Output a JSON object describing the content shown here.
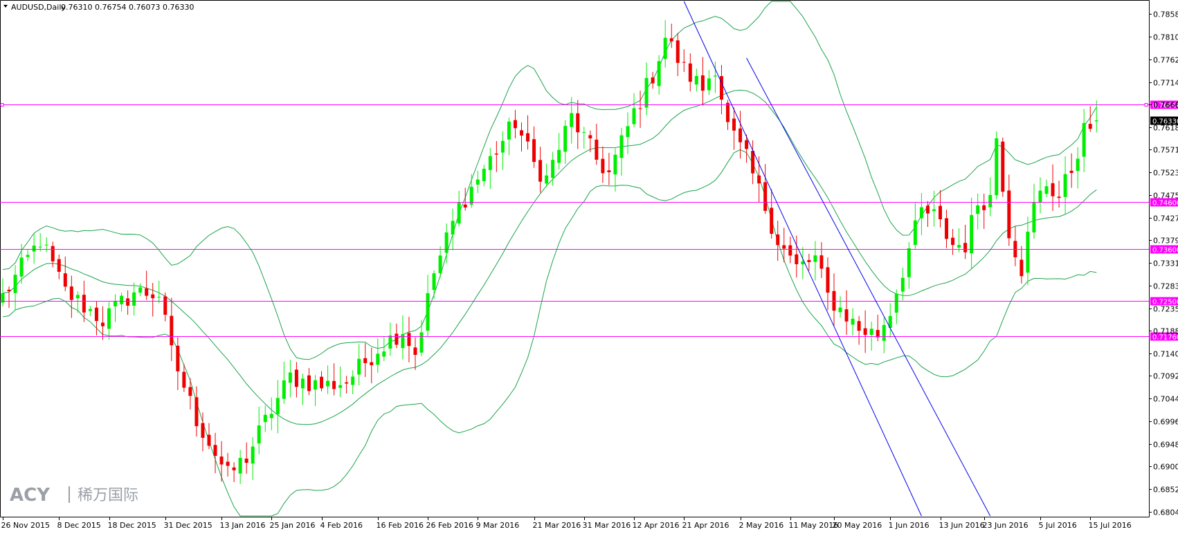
{
  "header": {
    "symbol": "AUDUSD,Daily",
    "ohlc": "0.76310 0.76754 0.76073 0.76330"
  },
  "logo": {
    "brand": "ACY",
    "cn": "稀万国际"
  },
  "colors": {
    "up": "#00ee00",
    "down": "#ee0000",
    "band": "#19a34a",
    "level": "#ff00ff",
    "channel": "#0000ee",
    "axis": "#000000",
    "current_price_bg": "#000000"
  },
  "chart_data": {
    "type": "candlestick",
    "symbol": "AUDUSD",
    "timeframe": "Daily",
    "ylim": [
      0.6795,
      0.7885
    ],
    "y_ticks": [
      "0.78580",
      "0.78100",
      "0.77620",
      "0.77140",
      "0.76660",
      "0.76180",
      "0.75710",
      "0.75230",
      "0.74750",
      "0.74270",
      "0.73790",
      "0.73310",
      "0.72830",
      "0.72350",
      "0.71880",
      "0.71400",
      "0.70920",
      "0.70440",
      "0.69960",
      "0.69480",
      "0.69000",
      "0.68520",
      "0.68040"
    ],
    "x_tick_labels": [
      "26 Nov 2015",
      "8 Dec 2015",
      "18 Dec 2015",
      "31 Dec 2015",
      "13 Jan 2016",
      "25 Jan 2016",
      "4 Feb 2016",
      "16 Feb 2016",
      "26 Feb 2016",
      "9 Mar 2016",
      "21 Mar 2016",
      "31 Mar 2016",
      "12 Apr 2016",
      "21 Apr 2016",
      "2 May 2016",
      "11 May 2016",
      "20 May 2016",
      "1 Jun 2016",
      "13 Jun 2016",
      "23 Jun 2016",
      "5 Jul 2016",
      "15 Jul 2016"
    ],
    "x_tick_index": [
      0,
      9,
      17,
      26,
      35,
      43,
      51,
      60,
      68,
      76,
      85,
      93,
      101,
      109,
      118,
      126,
      133,
      142,
      150,
      157,
      166,
      174
    ],
    "horizontal_levels": [
      {
        "value": 0.7666,
        "label": "0.76660"
      },
      {
        "value": 0.746,
        "label": "0.74600"
      },
      {
        "value": 0.736,
        "label": "0.73600"
      },
      {
        "value": 0.725,
        "label": "0.72500"
      },
      {
        "value": 0.7176,
        "label": "0.71760"
      }
    ],
    "current_price": {
      "value": 0.7633,
      "label": "0.76330"
    },
    "anchors": [
      [
        0,
        0.726
      ],
      [
        6,
        0.738
      ],
      [
        10,
        0.727
      ],
      [
        16,
        0.721
      ],
      [
        21,
        0.727
      ],
      [
        25,
        0.7265
      ],
      [
        27,
        0.714
      ],
      [
        31,
        0.7
      ],
      [
        36,
        0.688
      ],
      [
        39,
        0.692
      ],
      [
        43,
        0.702
      ],
      [
        46,
        0.709
      ],
      [
        51,
        0.707
      ],
      [
        55,
        0.708
      ],
      [
        60,
        0.715
      ],
      [
        64,
        0.719
      ],
      [
        66,
        0.714
      ],
      [
        69,
        0.731
      ],
      [
        73,
        0.745
      ],
      [
        77,
        0.753
      ],
      [
        82,
        0.763
      ],
      [
        85,
        0.754
      ],
      [
        87,
        0.751
      ],
      [
        91,
        0.764
      ],
      [
        95,
        0.755
      ],
      [
        97,
        0.752
      ],
      [
        101,
        0.765
      ],
      [
        104,
        0.773
      ],
      [
        106,
        0.781
      ],
      [
        109,
        0.774
      ],
      [
        112,
        0.77
      ],
      [
        114,
        0.775
      ],
      [
        116,
        0.762
      ],
      [
        119,
        0.755
      ],
      [
        122,
        0.745
      ],
      [
        124,
        0.738
      ],
      [
        127,
        0.732
      ],
      [
        130,
        0.734
      ],
      [
        132,
        0.726
      ],
      [
        135,
        0.722
      ],
      [
        137,
        0.719
      ],
      [
        140,
        0.718
      ],
      [
        142,
        0.723
      ],
      [
        145,
        0.736
      ],
      [
        147,
        0.744
      ],
      [
        149,
        0.743
      ],
      [
        152,
        0.737
      ],
      [
        154,
        0.737
      ],
      [
        156,
        0.746
      ],
      [
        158,
        0.747
      ],
      [
        159,
        0.76
      ],
      [
        161,
        0.74
      ],
      [
        163,
        0.732
      ],
      [
        165,
        0.745
      ],
      [
        167,
        0.75
      ],
      [
        169,
        0.747
      ],
      [
        171,
        0.753
      ],
      [
        173,
        0.761
      ],
      [
        175,
        0.7633
      ]
    ],
    "channel_lines": [
      {
        "from": [
          109,
          0.7885
        ],
        "to": [
          147,
          0.6795
        ]
      },
      {
        "from": [
          119,
          0.7765
        ],
        "to": [
          158,
          0.6795
        ]
      }
    ],
    "bollinger_period": 20,
    "bollinger_std": 2
  }
}
